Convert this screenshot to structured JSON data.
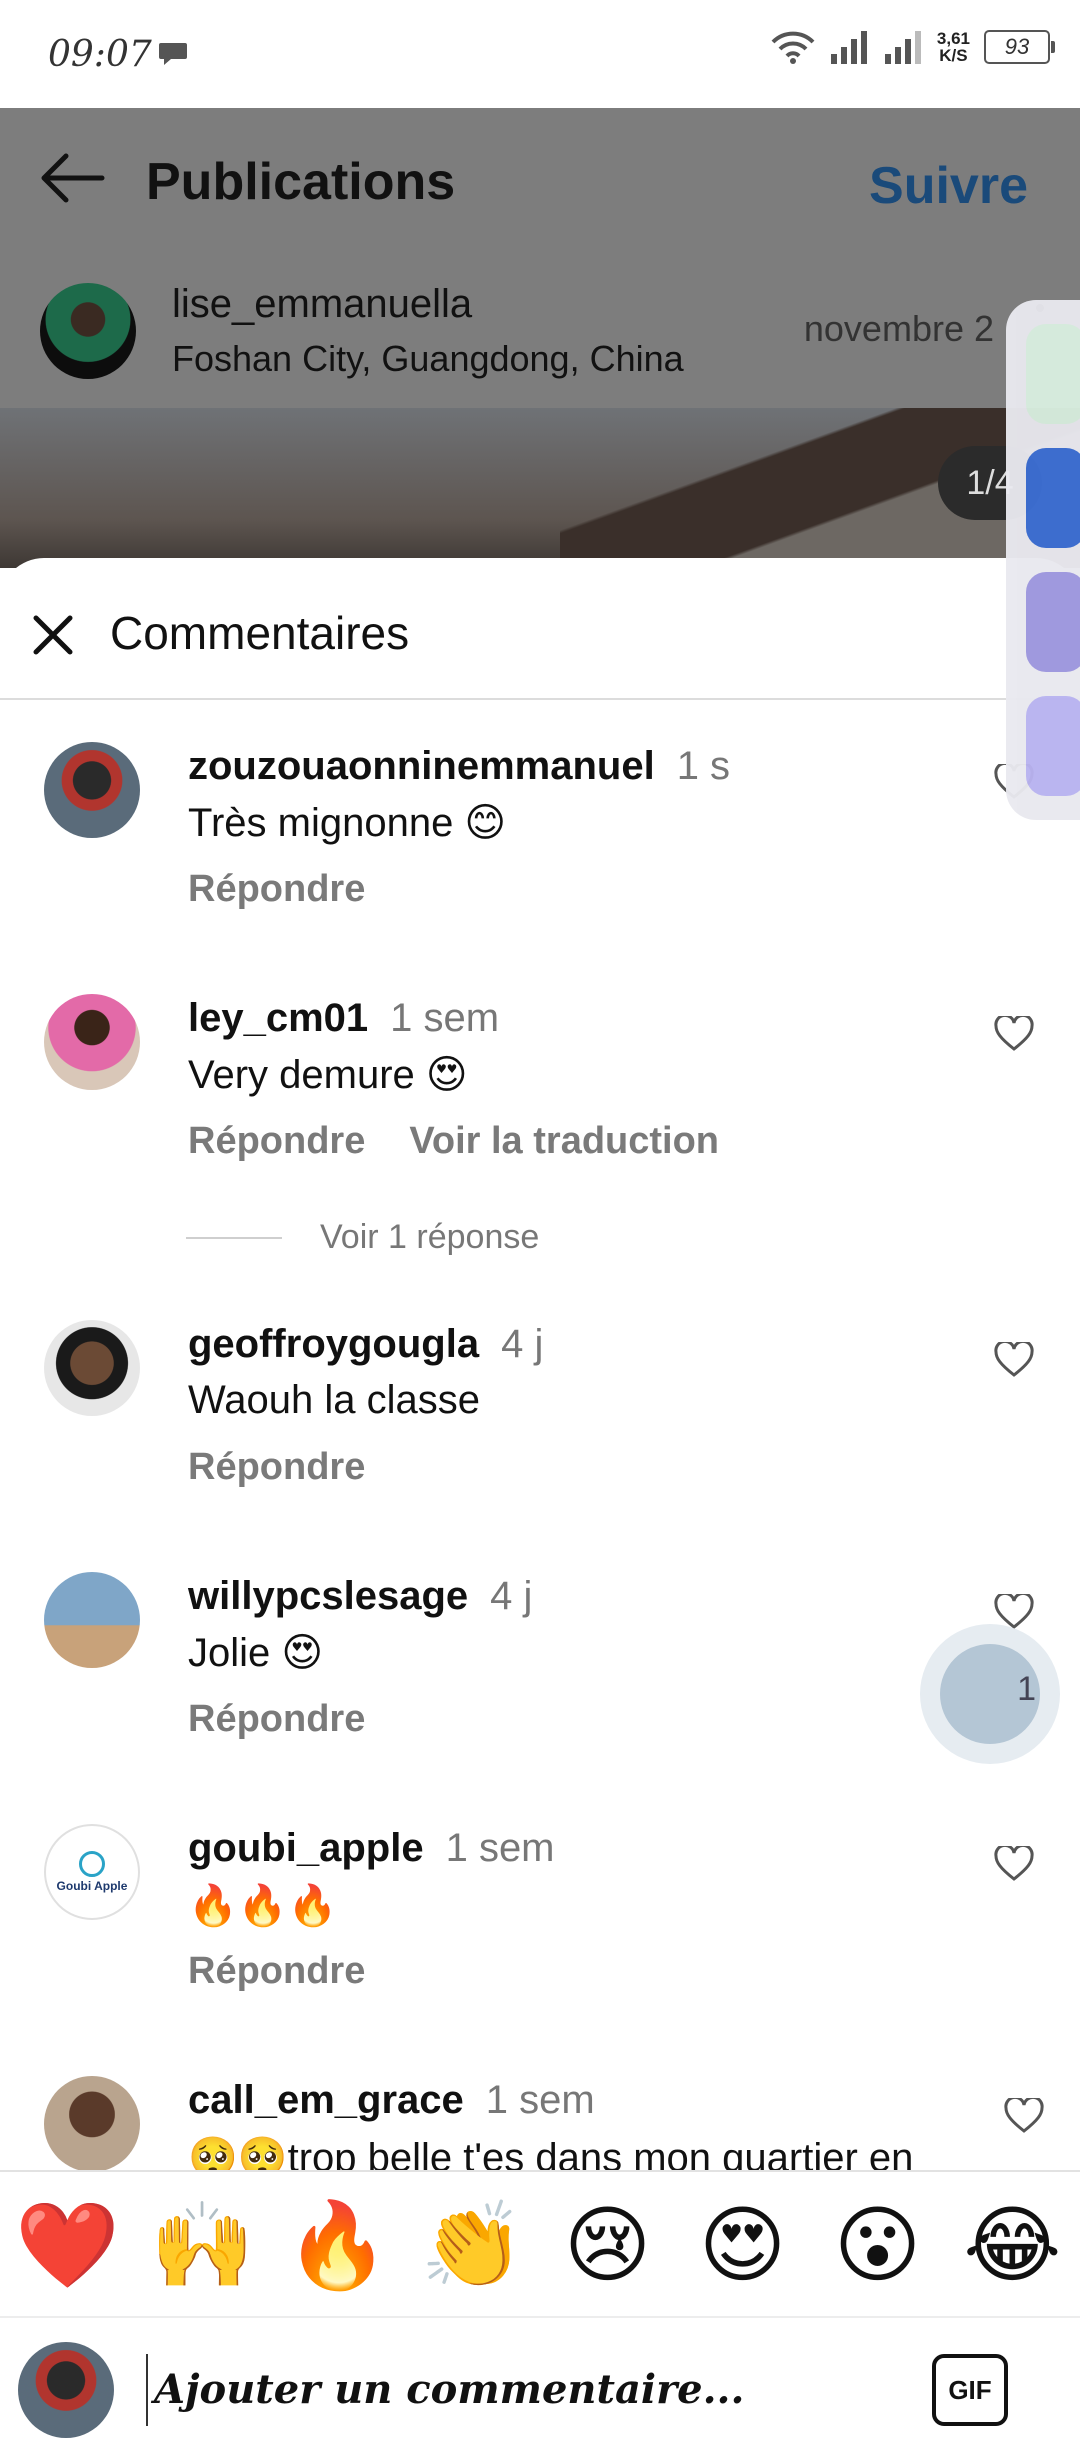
{
  "status_bar": {
    "time": "09:07",
    "net_speed_value": "3,61",
    "net_speed_unit": "K/S",
    "battery": "93"
  },
  "header": {
    "title": "Publications",
    "follow_label": "Suivre"
  },
  "post": {
    "author": "lise_emmanuella",
    "location": "Foshan City, Guangdong, China",
    "date": "novembre 2",
    "image_counter": "1/4"
  },
  "comments_sheet": {
    "title": "Commentaires",
    "reply_label": "Répondre",
    "translate_label": "Voir la traduction",
    "see_replies_label": "Voir 1 réponse",
    "comments": [
      {
        "user": "zouzouaonninemmanuel",
        "time": "1 s",
        "text": "Très mignonne 😊",
        "show_translate": false
      },
      {
        "user": "ley_cm01",
        "time": "1 sem",
        "text": "Very demure 😍",
        "show_translate": true
      },
      {
        "user": "geoffroygougla",
        "time": "4 j",
        "text": "Waouh la classe",
        "show_translate": false
      },
      {
        "user": "willypcslesage",
        "time": "4 j",
        "text": "Jolie 😍",
        "show_translate": false
      },
      {
        "user": "goubi_apple",
        "time": "1 sem",
        "text": "🔥🔥🔥",
        "show_translate": false
      },
      {
        "user": "call_em_grace",
        "time": "1 sem",
        "text": "🥺🥺trop belle t'es dans mon quartier en",
        "show_translate": false
      }
    ],
    "scroll_indicator": "1",
    "goubi_logo_text": "Goubi Apple"
  },
  "reaction_bar": {
    "emojis": [
      "❤️",
      "🙌",
      "🔥",
      "👏",
      "😢",
      "😍",
      "😮",
      "😂"
    ]
  },
  "composer": {
    "placeholder": "Ajouter un commentaire...",
    "gif_label": "GIF"
  },
  "colors": {
    "follow_blue": "#1a4a7a",
    "secondary_text": "#7a7a7a",
    "dim_overlay": "#7d7d7d"
  }
}
